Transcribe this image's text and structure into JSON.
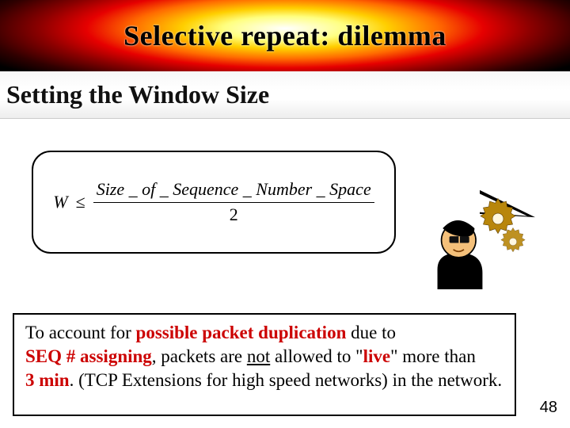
{
  "title": "Selective repeat: dilemma",
  "subtitle": "Setting the Window Size",
  "formula": {
    "lhs": "W",
    "operator": "≤",
    "numerator": "Size _ of _ Sequence _ Number _ Space",
    "denominator": "2"
  },
  "note": {
    "t1": "To account for ",
    "t2": "possible packet duplication",
    "t3": " due to ",
    "t4": "SEQ # assigning",
    "t5": ", packets are ",
    "t6": "not",
    "t7": " allowed to \"",
    "t8": "live",
    "t9": "\" more than ",
    "t10": "3 min",
    "t11": ". (TCP Extensions for high speed networks) in the network."
  },
  "page_number": "48"
}
